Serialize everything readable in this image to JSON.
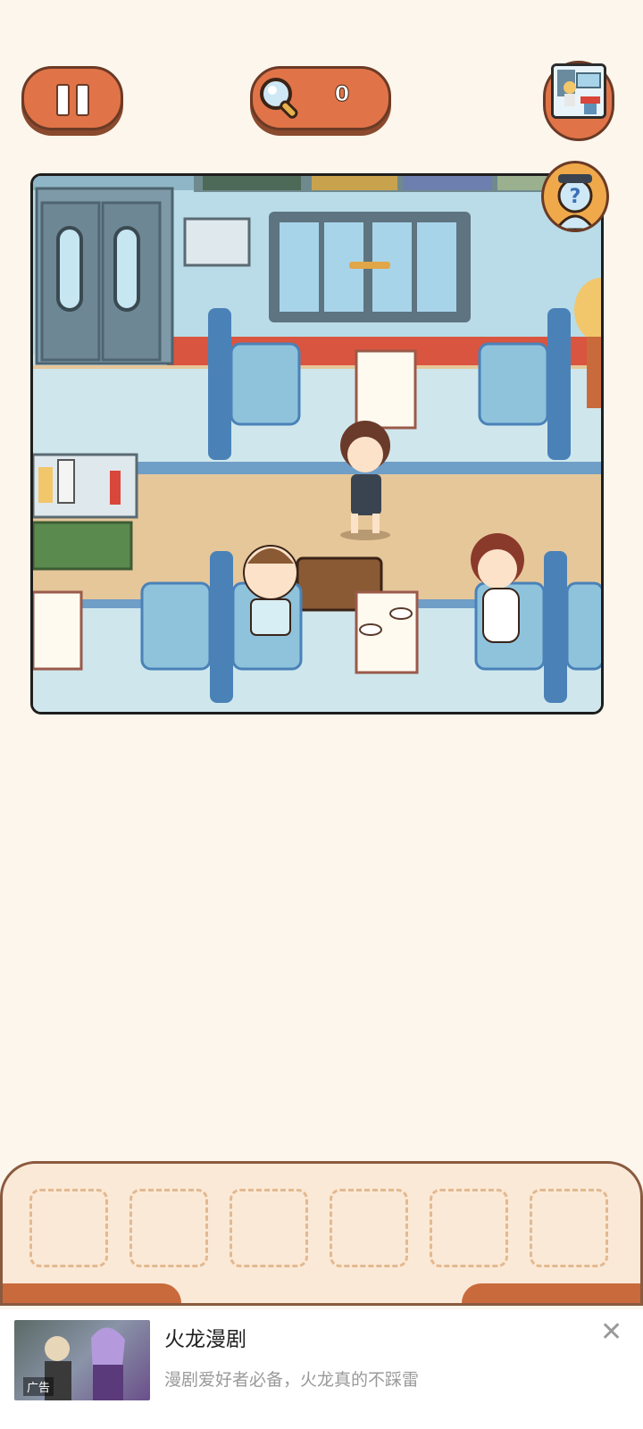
{
  "hud": {
    "hint_count": "0",
    "pause_icon": "pause-icon",
    "magnifier_icon": "magnifier-icon"
  },
  "scene": {
    "name": "train-dining-car",
    "characters": [
      "woman-with-glasses-walking",
      "old-man-sitting",
      "girl-with-glasses-sitting",
      "blonde-woman-partial"
    ]
  },
  "tray": {
    "slots": 6
  },
  "ad": {
    "title": "火龙漫剧",
    "description": "漫剧爱好者必备，火龙真的不踩雷",
    "tag": "广告",
    "close_icon": "close-icon"
  },
  "colors": {
    "background": "#fdf6ec",
    "button_orange": "#e07448",
    "seat_blue": "#8fc3dc",
    "tray_bg": "#fbe9d7"
  }
}
